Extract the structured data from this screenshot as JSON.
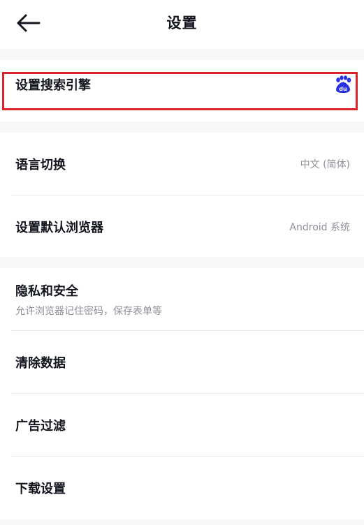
{
  "header": {
    "back_icon": "arrow-left-icon",
    "title": "设置"
  },
  "search_engine": {
    "label": "设置搜索引擎",
    "icon": "baidu-paw-icon",
    "icon_text": "du",
    "icon_color": "#2932e1",
    "highlight_color": "#d8232a"
  },
  "general": {
    "language": {
      "label": "语言切换",
      "value": "中文 (简体)"
    },
    "default_browser": {
      "label": "设置默认浏览器",
      "value": "Android 系统"
    }
  },
  "privacy": {
    "privacy_security": {
      "label": "隐私和安全",
      "subtitle": "允许浏览器记住密码，保存表单等"
    },
    "clear_data": {
      "label": "清除数据"
    },
    "ad_filter": {
      "label": "广告过滤"
    },
    "download_settings": {
      "label": "下载设置"
    }
  }
}
